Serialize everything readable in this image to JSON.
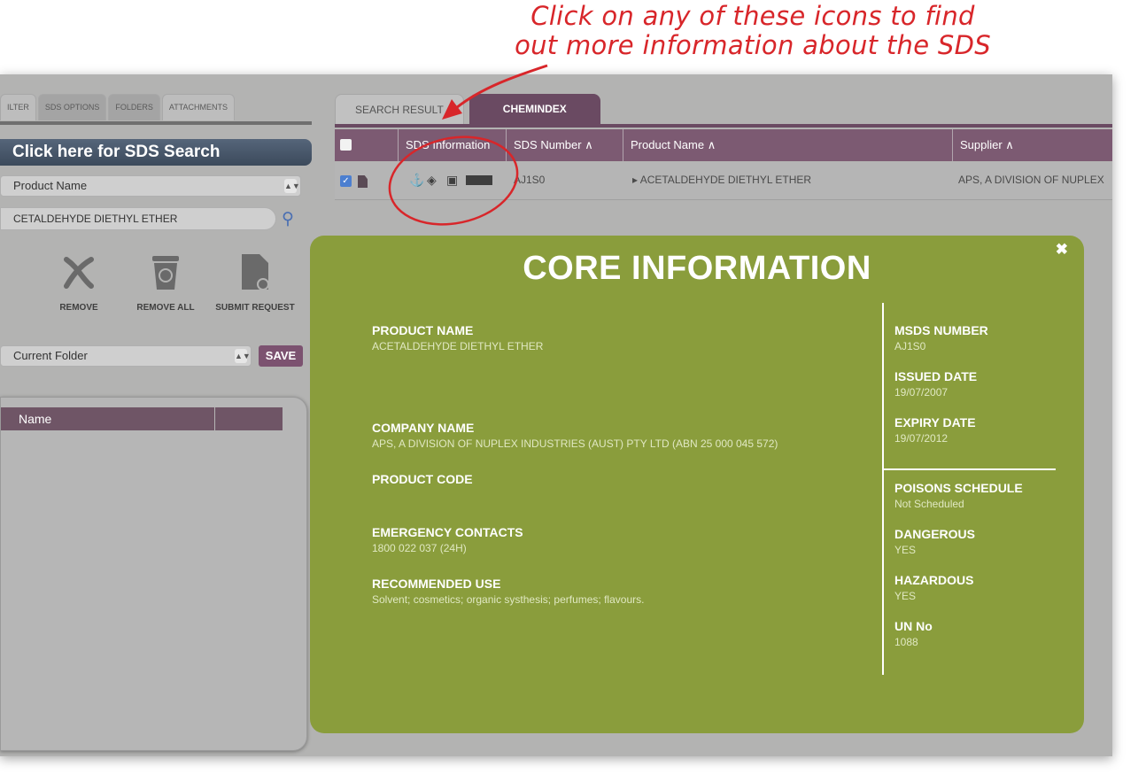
{
  "annotation": {
    "line1": "Click on any of these icons to find",
    "line2": "out more information about the SDS"
  },
  "left_tabs": [
    "ILTER",
    "SDS OPTIONS",
    "FOLDERS",
    "ATTACHMENTS"
  ],
  "sds_search_button": "Click here for SDS Search",
  "search_field_select": "Product Name",
  "search_input_value": "CETALDEHYDE DIETHYL ETHER",
  "actions": {
    "remove": "REMOVE",
    "remove_all": "REMOVE ALL",
    "submit_request": "SUBMIT REQUEST"
  },
  "folder_select": "Current Folder",
  "save_label": "SAVE",
  "folder_table_header": "Name",
  "right_tabs": {
    "search_result": "SEARCH RESULT",
    "chemindex": "CHEMINDEX"
  },
  "table": {
    "headers": {
      "sds_info": "SDS Information",
      "sds_number": "SDS Number ∧",
      "product_name": "Product Name ∧",
      "supplier": "Supplier ∧"
    },
    "row": {
      "sds_number": "AJ1S0",
      "product_name": "▸  ACETALDEHYDE DIETHYL ETHER",
      "supplier": "APS, A DIVISION OF NUPLEX"
    }
  },
  "modal": {
    "close": "✖",
    "title": "CORE INFORMATION",
    "product_name_label": "PRODUCT NAME",
    "product_name_value": "ACETALDEHYDE DIETHYL ETHER",
    "company_name_label": "COMPANY NAME",
    "company_name_value": "APS, A DIVISION OF NUPLEX INDUSTRIES (AUST) PTY LTD (ABN 25 000 045 572)",
    "product_code_label": "PRODUCT CODE",
    "emergency_label": "EMERGENCY CONTACTS",
    "emergency_value": "1800 022 037 (24H)",
    "recommended_label": "RECOMMENDED USE",
    "recommended_value": "Solvent; cosmetics; organic systhesis; perfumes; flavours.",
    "msds_number_label": "MSDS NUMBER",
    "msds_number_value": "AJ1S0",
    "issued_label": "ISSUED DATE",
    "issued_value": "19/07/2007",
    "expiry_label": "EXPIRY DATE",
    "expiry_value": "19/07/2012",
    "poisons_label": "POISONS SCHEDULE",
    "poisons_value": "Not Scheduled",
    "dangerous_label": "DANGEROUS",
    "dangerous_value": "YES",
    "hazardous_label": "HAZARDOUS",
    "hazardous_value": "YES",
    "un_label": "UN No",
    "un_value": "1088"
  },
  "colors": {
    "annotation": "#d8262a",
    "modal_bg": "#8a9d3c",
    "table_header": "#7c5a72",
    "save_button": "#7c5270"
  }
}
